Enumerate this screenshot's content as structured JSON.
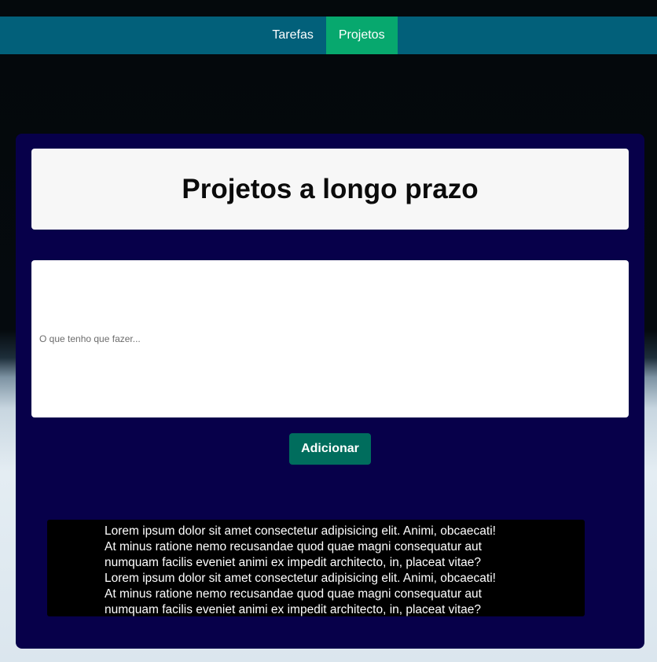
{
  "nav": {
    "items": [
      {
        "label": "Tarefas",
        "active": false
      },
      {
        "label": "Projetos",
        "active": true
      }
    ]
  },
  "main": {
    "title": "Projetos a longo prazo",
    "input_placeholder": "O que tenho que fazer...",
    "input_value": "",
    "add_button_label": "Adicionar"
  },
  "items": [
    {
      "lines": [
        "Lorem ipsum dolor sit amet consectetur adipisicing elit. Animi, obcaecati!",
        "At minus ratione nemo recusandae quod quae magni consequatur aut",
        "numquam facilis eveniet animi ex impedit architecto, in, placeat vitae?",
        "Lorem ipsum dolor sit amet consectetur adipisicing elit. Animi, obcaecati!",
        "At minus ratione nemo recusandae quod quae magni consequatur aut",
        "numquam facilis eveniet animi ex impedit architecto, in, placeat vitae?"
      ]
    }
  ],
  "colors": {
    "navbar": "#02607a",
    "nav_active": "#07a86e",
    "card": "#07004a",
    "button": "#006d5d"
  }
}
